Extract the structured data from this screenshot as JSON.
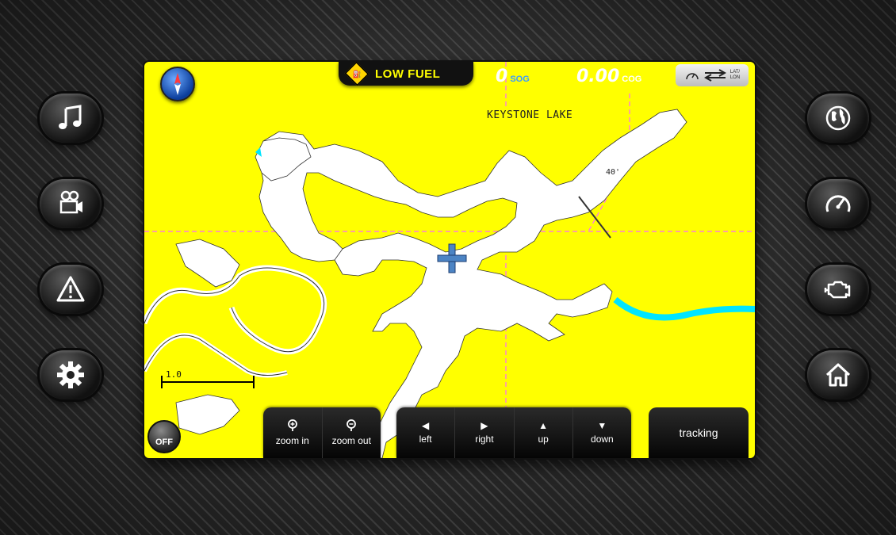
{
  "status": {
    "fuel_warning": "LOW FUEL",
    "sog_value": "0",
    "sog_unit": "SOG",
    "cog_value": "0.00",
    "cog_unit": "COG",
    "latlon_label_1": "LAT/",
    "latlon_label_2": "LON"
  },
  "map": {
    "lake_name": "KEYSTONE LAKE",
    "depth_marker": "40'",
    "scale_label": "1.0",
    "colors": {
      "land": "#ffff00",
      "water": "#ffffff",
      "river": "#00e5ff",
      "grid": "#ff66ff"
    }
  },
  "left_menu": [
    {
      "icon": "music-note-icon"
    },
    {
      "icon": "video-camera-icon"
    },
    {
      "icon": "warning-icon"
    },
    {
      "icon": "gear-icon"
    }
  ],
  "right_menu": [
    {
      "icon": "globe-icon"
    },
    {
      "icon": "speedometer-icon"
    },
    {
      "icon": "engine-icon"
    },
    {
      "icon": "home-icon"
    }
  ],
  "controls": {
    "off_label": "OFF",
    "zoom_in": "zoom in",
    "zoom_out": "zoom out",
    "left": "left",
    "right": "right",
    "up": "up",
    "down": "down",
    "tracking": "tracking"
  }
}
